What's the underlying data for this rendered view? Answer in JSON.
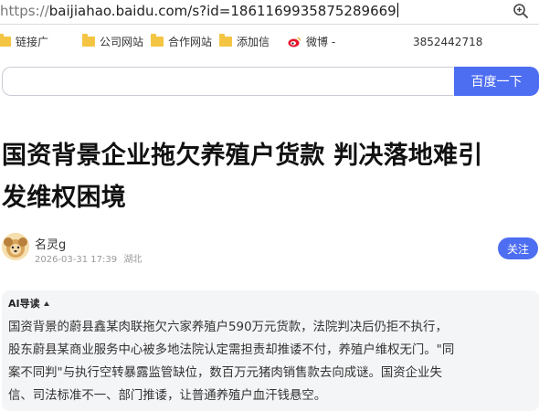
{
  "browser": {
    "address": {
      "scheme": "https://",
      "host_path": "baijiahao.baidu.com/s?id=1861169935875289669"
    },
    "zoom_icon": "zoom-in-icon",
    "bookmarks": [
      {
        "label": "链接广",
        "icon": "folder-icon"
      },
      {
        "label": "公司网站",
        "icon": "folder-icon"
      },
      {
        "label": "合作网站",
        "icon": "folder-icon"
      },
      {
        "label": "添加信",
        "icon": "folder-icon"
      },
      {
        "label": "微博 -",
        "icon": "weibo-icon"
      }
    ],
    "bookmark_phone": "3852442718"
  },
  "search": {
    "value": "",
    "button_label": "百度一下"
  },
  "article": {
    "title_line1": "国资背景企业拖欠养殖户货款 判决落地难引",
    "title_line2": "发维权困境",
    "author": {
      "name": "名灵g",
      "date": "2026-03-31 17:39",
      "location": "湖北",
      "follow_label": "关注"
    },
    "ai_summary": {
      "heading": "AI导读",
      "line1": "国资背景的蔚县鑫某肉联拖欠六家养殖户590万元货款，法院判决后仍拒不执行，",
      "line2": "股东蔚县某商业服务中心被多地法院认定需担责却推诿不付，养殖户维权无门。\"同",
      "line3": "案不同判\"与执行空转暴露监管缺位，数百万元猪肉销售款去向成谜。国资企业失",
      "line4": "信、司法标准不一、部门推诿，让普通养殖户血汗钱悬空。"
    }
  },
  "colors": {
    "accent": "#4e6ef2",
    "folder": "#f4c542",
    "ai_box_bg": "#f4f5f7"
  }
}
